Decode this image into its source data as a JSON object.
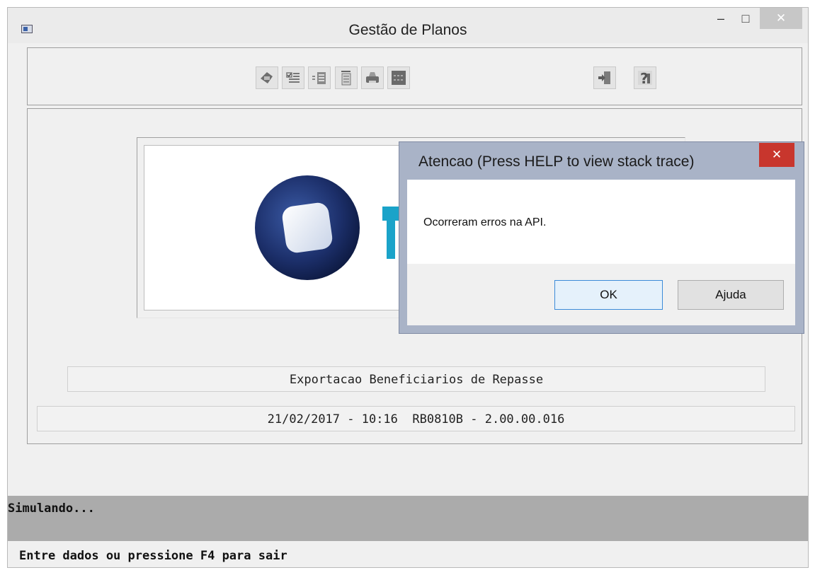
{
  "window": {
    "title": "Gestão de Planos",
    "minimize_symbol": "–",
    "maximize_symbol": "□",
    "close_symbol": "✕"
  },
  "toolbar": {
    "icons": [
      "form-icon",
      "checklist-icon",
      "insert-icon",
      "document-icon",
      "printer-icon",
      "grid-icon",
      "exit-icon",
      "help-icon"
    ]
  },
  "info": {
    "program_title": "Exportacao Beneficiarios de Repasse",
    "build_line": "21/02/2017 - 10:16  RB0810B - 2.00.00.016"
  },
  "status": {
    "message": "Simulando...",
    "prompt": "Entre dados ou pressione F4 para sair"
  },
  "dialog": {
    "title": "Atencao (Press HELP to view stack trace)",
    "close_symbol": "✕",
    "message": "Ocorreram erros na API.",
    "ok_label": "OK",
    "help_label": "Ajuda"
  },
  "colors": {
    "logo_accent": "#1aa3c9",
    "dialog_close": "#c8362d",
    "status_bar": "#ababab"
  }
}
